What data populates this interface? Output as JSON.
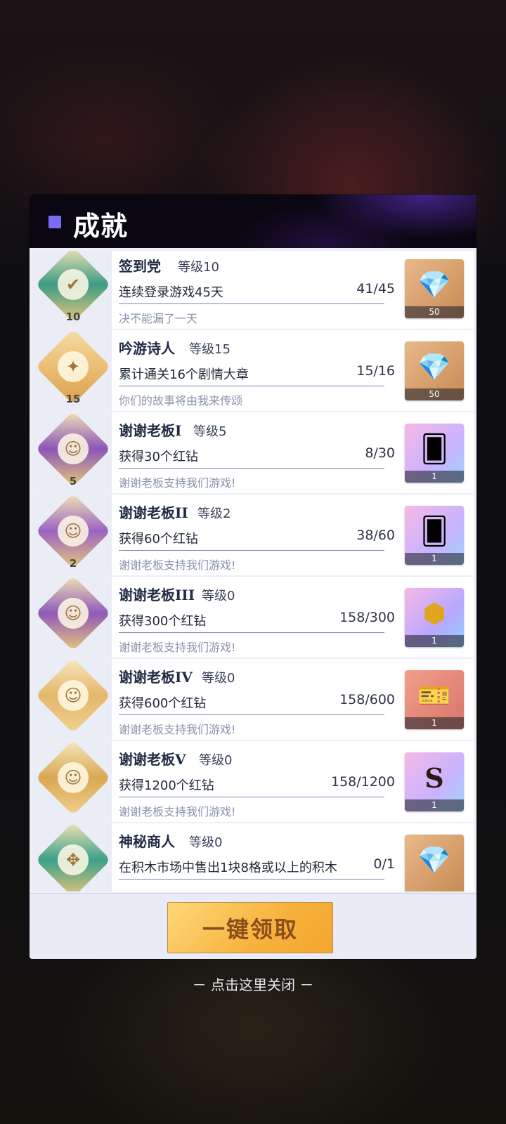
{
  "modal": {
    "title": "成就",
    "claim_button": "一键领取",
    "close_hint": "－ 点击这里关闭 －"
  },
  "achievements": [
    {
      "name": "签到党",
      "level": "等级10",
      "desc": "连续登录游戏45天",
      "progress": "41/45",
      "flavor": "决不能漏了一天",
      "badge_level": "10",
      "badge_icon": "checkmark-icon",
      "reward_icon": "diamond-icon",
      "reward_count": "50"
    },
    {
      "name": "吟游诗人",
      "level": "等级15",
      "desc": "累计通关16个剧情大章",
      "progress": "15/16",
      "flavor": "你们的故事将由我来传颂",
      "badge_level": "15",
      "badge_icon": "wizard-hat-icon",
      "reward_icon": "diamond-icon",
      "reward_count": "50"
    },
    {
      "name": "谢谢老板I",
      "level": "等级5",
      "desc": "获得30个红钻",
      "progress": "8/30",
      "flavor": "谢谢老板支持我们游戏!",
      "badge_level": "5",
      "badge_icon": "mascot-icon",
      "reward_icon": "red-card-icon",
      "reward_count": "1"
    },
    {
      "name": "谢谢老板II",
      "level": "等级2",
      "desc": "获得60个红钻",
      "progress": "38/60",
      "flavor": "谢谢老板支持我们游戏!",
      "badge_level": "2",
      "badge_icon": "mascot-icon",
      "reward_icon": "blue-card-icon",
      "reward_count": "1"
    },
    {
      "name": "谢谢老板III",
      "level": "等级0",
      "desc": "获得300个红钻",
      "progress": "158/300",
      "flavor": "谢谢老板支持我们游戏!",
      "badge_level": "",
      "badge_icon": "mascot-icon",
      "reward_icon": "gold-box-icon",
      "reward_count": "1"
    },
    {
      "name": "谢谢老板IV",
      "level": "等级0",
      "desc": "获得600个红钻",
      "progress": "158/600",
      "flavor": "谢谢老板支持我们游戏!",
      "badge_level": "",
      "badge_icon": "mascot-icon",
      "reward_icon": "gold-ticket-icon",
      "reward_count": "1"
    },
    {
      "name": "谢谢老板V",
      "level": "等级0",
      "desc": "获得1200个红钻",
      "progress": "158/1200",
      "flavor": "谢谢老板支持我们游戏!",
      "badge_level": "",
      "badge_icon": "mascot-icon",
      "reward_icon": "s-card-icon",
      "reward_count": "1"
    },
    {
      "name": "神秘商人",
      "level": "等级0",
      "desc": "在积木市场中售出1块8格或以上的积木",
      "progress": "0/1",
      "flavor": "",
      "badge_level": "",
      "badge_icon": "knot-icon",
      "reward_icon": "diamond-icon",
      "reward_count": ""
    }
  ],
  "colors": {
    "accent": "#7b6cf6",
    "button_gold": "#f6b23c",
    "button_text": "#8a4f1a"
  }
}
